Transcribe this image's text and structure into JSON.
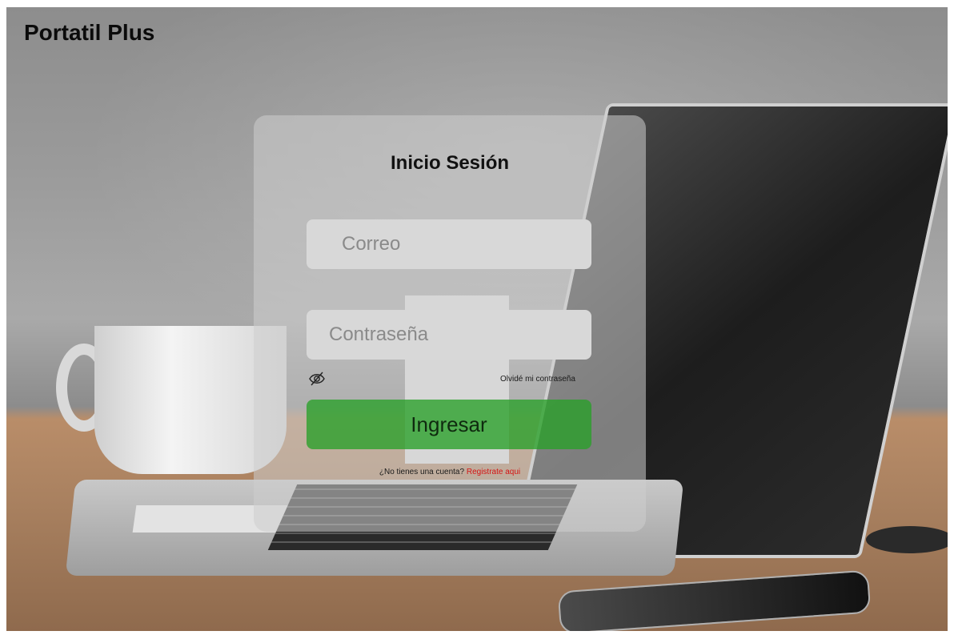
{
  "app": {
    "brand": "Portatil Plus"
  },
  "login": {
    "title": "Inicio Sesión",
    "email_placeholder": "Correo",
    "password_placeholder": "Contraseña",
    "forgot_password": "Olvidé mi contraseña",
    "submit_label": "Ingresar",
    "signup_prompt": "¿No tienes una cuenta?",
    "signup_link": "Registrate aqui"
  },
  "colors": {
    "accent_green": "#2ea02e",
    "signup_link": "#d41414"
  },
  "icons": {
    "password_toggle": "eye-slash-icon"
  }
}
